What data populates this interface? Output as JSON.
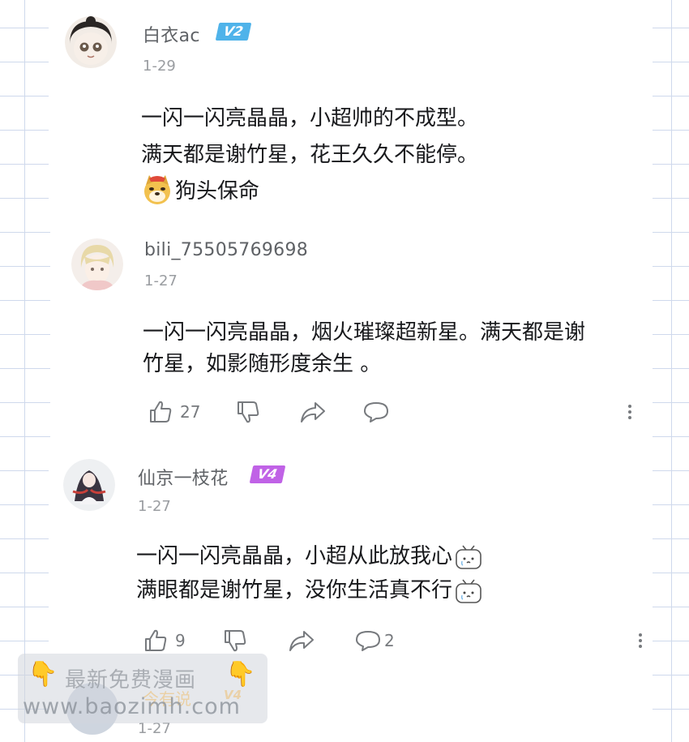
{
  "comments": [
    {
      "username": "白衣ac",
      "level": "V2",
      "level_color": "#4fb3ea",
      "date": "1-29",
      "lines": [
        "一闪一闪亮晶晶，小超帅的不成型。",
        "满天都是谢竹星，花王久久不能停。"
      ],
      "emoji_label": "狗头保命",
      "emoji_icon": "doge-emoji-icon"
    },
    {
      "username": "bili_75505769698",
      "date": "1-27",
      "lines": [
        "一闪一闪亮晶晶，烟火璀璨超新星。满天都是谢",
        "竹星，如影随形度余生 。"
      ],
      "likes": "27"
    },
    {
      "username": "仙京一枝花",
      "level": "V4",
      "level_color": "#c062e6",
      "date": "1-27",
      "lines": [
        "一闪一闪亮晶晶，小超从此放我心",
        "满眼都是谢竹星，没你生活真不行"
      ],
      "likes": "9",
      "replies": "2"
    },
    {
      "date": "1-27"
    }
  ],
  "watermark": {
    "line1": "最新免费漫画",
    "line2": "www.baozimh.com",
    "faded_name": "今有说",
    "faded_level": "V4"
  }
}
